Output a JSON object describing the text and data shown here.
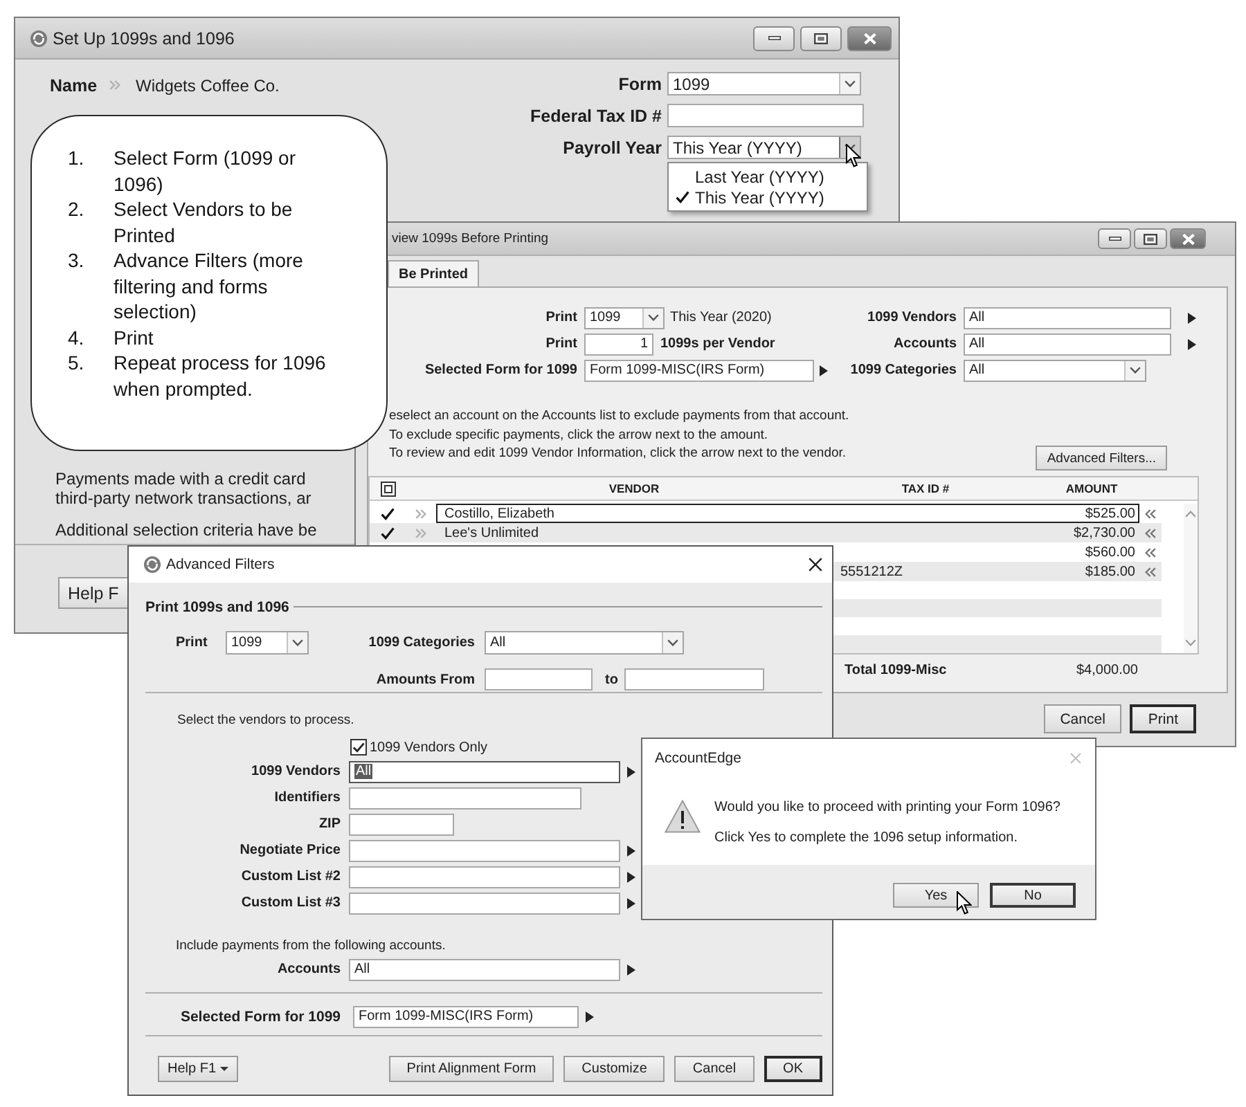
{
  "setup_window": {
    "title": "Set Up 1099s and 1096",
    "name": {
      "label": "Name",
      "value": "Widgets Coffee Co."
    },
    "fields": [
      {
        "kind": "combo",
        "label": "Form",
        "value": "1099",
        "expanded": false
      },
      {
        "kind": "text",
        "label": "Federal Tax ID #"
      },
      {
        "kind": "combo",
        "label": "Payroll Year",
        "value": "This Year (YYYY)",
        "expanded": true,
        "options": [
          {
            "label": "Last Year (YYYY)",
            "selected": false
          },
          {
            "label": "This Year (YYYY)",
            "selected": true
          }
        ]
      }
    ],
    "notes": [
      "Payments made with a credit card",
      "third-party network transactions, ar",
      "Additional selection criteria have be"
    ],
    "help_button": "Help F"
  },
  "callout": {
    "steps": [
      {
        "number": "1.",
        "text": "Select Form (1099 or 1096)"
      },
      {
        "number": "2.",
        "text": "Select Vendors to be Printed"
      },
      {
        "number": "3.",
        "text": "Advance Filters (more filtering and forms selection)"
      },
      {
        "number": "4.",
        "text": "Print"
      },
      {
        "number": "5.",
        "text": "Repeat process for 1096 when prompted."
      }
    ]
  },
  "preview_window": {
    "title": "view 1099s Before Printing",
    "tabs": [
      {
        "label": "Be Printed",
        "selected": true
      }
    ],
    "settings": [
      {
        "left": {
          "kind": "combo",
          "label": "Print",
          "value": "1099",
          "suffix": "This Year (2020)"
        },
        "right": {
          "kind": "lookup",
          "label": "1099 Vendors",
          "value": "All"
        }
      },
      {
        "left": {
          "kind": "number",
          "label": "Print",
          "value": "1",
          "suffix": "1099s per Vendor"
        },
        "right": {
          "kind": "lookup",
          "label": "Accounts",
          "value": "All"
        }
      },
      {
        "left": {
          "kind": "lookup",
          "label": "Selected Form for 1099",
          "value": "Form 1099-MISC(IRS Form)"
        },
        "right": {
          "kind": "combo",
          "label": "1099 Categories",
          "value": "All"
        }
      }
    ],
    "instructions": [
      "eselect an account on the Accounts list to exclude payments from that account.",
      "To exclude specific payments, click the arrow next to the amount.",
      "To review and edit 1099 Vendor Information, click the arrow next to the vendor."
    ],
    "advanced_button": "Advanced Filters...",
    "table": {
      "header_checkbox": {
        "checked": true
      },
      "columns": [
        "VENDOR",
        "TAX ID #",
        "AMOUNT"
      ],
      "rows": [
        {
          "checked": true,
          "selected": true,
          "vendor": "Costillo, Elizabeth",
          "amount": "$525.00"
        },
        {
          "checked": true,
          "selected": false,
          "vendor": "Lee's Unlimited",
          "amount": "$2,730.00"
        },
        {
          "selected": false,
          "amount": "$560.00"
        },
        {
          "selected": false,
          "tax_id": "5551212Z",
          "amount": "$185.00"
        }
      ]
    },
    "total": {
      "label": "Total 1099-Misc",
      "value": "$4,000.00"
    },
    "buttons": [
      {
        "label": "Cancel",
        "default": false
      },
      {
        "label": "Print",
        "default": true
      }
    ]
  },
  "advanced_filters": {
    "title": "Advanced Filters",
    "group": "Print 1099s and 1096",
    "print": {
      "label": "Print",
      "value": "1099"
    },
    "categories": {
      "label": "1099 Categories",
      "value": "All"
    },
    "amounts": {
      "label": "Amounts From",
      "to_label": "to"
    },
    "vendor_prompt": "Select the vendors to process.",
    "vendors_only": {
      "label": "1099 Vendors Only",
      "checked": true
    },
    "filters": [
      {
        "kind": "lookup",
        "label": "1099 Vendors",
        "value": "All",
        "focused": true
      },
      {
        "kind": "text",
        "label": "Identifiers",
        "focused": false
      },
      {
        "kind": "postal",
        "label": "ZIP",
        "focused": false
      },
      {
        "kind": "lookup",
        "label": "Negotiate Price",
        "focused": false
      },
      {
        "kind": "lookup",
        "label": "Custom List #2",
        "focused": false
      },
      {
        "kind": "lookup",
        "label": "Custom List #3",
        "focused": false
      }
    ],
    "accounts_prompt": "Include payments from the following accounts.",
    "accounts": {
      "kind": "lookup",
      "label": "Accounts",
      "value": "All"
    },
    "selected_form": {
      "kind": "lookup",
      "label": "Selected Form for 1099",
      "value": "Form 1099-MISC(IRS Form)"
    },
    "help_button": "Help F1",
    "buttons": [
      {
        "label": "Print Alignment Form",
        "default": false
      },
      {
        "label": "Customize",
        "default": false
      },
      {
        "label": "Cancel",
        "default": false
      },
      {
        "label": "OK",
        "default": true
      }
    ]
  },
  "dialog": {
    "title": "AccountEdge",
    "message": "Would you like to proceed with printing your Form 1096?",
    "detail": "Click Yes to complete the 1096 setup information.",
    "buttons": [
      {
        "label": "Yes",
        "default": false
      },
      {
        "label": "No",
        "default": true
      }
    ]
  }
}
